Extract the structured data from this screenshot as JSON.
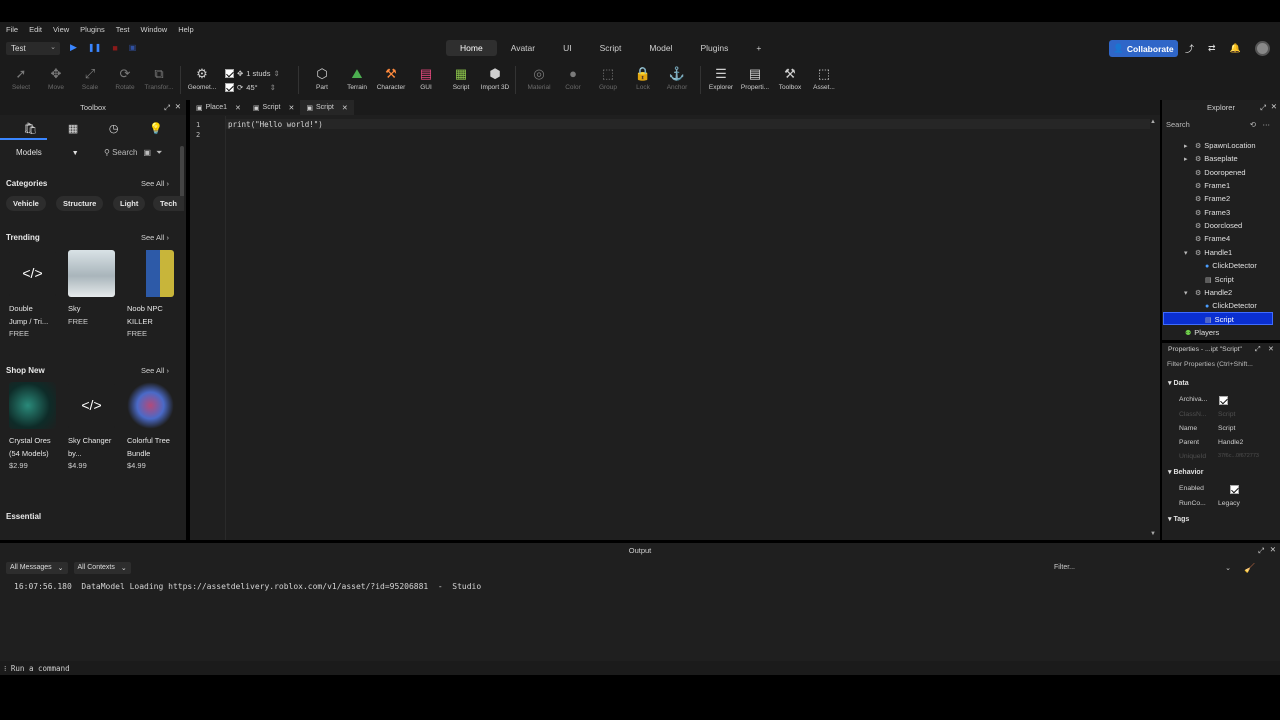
{
  "menu": [
    "File",
    "Edit",
    "View",
    "Plugins",
    "Test",
    "Window",
    "Help"
  ],
  "toolbar": {
    "mode_select": "Test",
    "collaborate_label": "Collaborate"
  },
  "main_tabs": [
    {
      "label": "Home",
      "active": true
    },
    {
      "label": "Avatar"
    },
    {
      "label": "UI"
    },
    {
      "label": "Script"
    },
    {
      "label": "Model"
    },
    {
      "label": "Plugins"
    },
    {
      "label": "+"
    }
  ],
  "ribbon": {
    "tools": [
      {
        "label": "Select",
        "icon": "cursor-icon",
        "dim": true
      },
      {
        "label": "Move",
        "icon": "move-icon",
        "dim": true
      },
      {
        "label": "Scale",
        "icon": "scale-icon",
        "dim": true
      },
      {
        "label": "Rotate",
        "icon": "rotate-icon",
        "dim": true
      },
      {
        "label": "Transfor...",
        "icon": "transform-icon",
        "dim": true
      },
      {
        "label": "Geomet...",
        "icon": "geometry-icon"
      },
      {
        "label": "Part",
        "icon": "part-icon"
      },
      {
        "label": "Terrain",
        "icon": "terrain-icon"
      },
      {
        "label": "Character",
        "icon": "character-icon"
      },
      {
        "label": "GUI",
        "icon": "gui-icon"
      },
      {
        "label": "Script",
        "icon": "script-icon"
      },
      {
        "label": "Import 3D",
        "icon": "import-3d-icon"
      },
      {
        "label": "Material",
        "icon": "material-icon",
        "dim": true
      },
      {
        "label": "Color",
        "icon": "color-icon",
        "dim": true
      },
      {
        "label": "Group",
        "icon": "group-icon",
        "dim": true
      },
      {
        "label": "Lock",
        "icon": "lock-icon",
        "dim": true
      },
      {
        "label": "Anchor",
        "icon": "anchor-icon",
        "dim": true
      },
      {
        "label": "Explorer",
        "icon": "explorer-icon"
      },
      {
        "label": "Properti...",
        "icon": "properties-icon"
      },
      {
        "label": "Toolbox",
        "icon": "toolbox-icon"
      },
      {
        "label": "Asset...",
        "icon": "asset-icon"
      }
    ],
    "snap": {
      "move": "1 studs",
      "rotate": "45°"
    }
  },
  "toolbox": {
    "title": "Toolbox",
    "category_select": "Models",
    "search_placeholder": "Search",
    "sections": {
      "categories": {
        "title": "Categories",
        "see_all": "See All"
      },
      "trending": {
        "title": "Trending",
        "see_all": "See All"
      },
      "shop_new": {
        "title": "Shop New",
        "see_all": "See All"
      },
      "essential": {
        "title": "Essential"
      }
    },
    "chips": [
      "Vehicle",
      "Structure",
      "Light",
      "Tech"
    ],
    "trending_items": [
      {
        "name1": "Double",
        "name2": "Jump / Tri...",
        "price": "FREE"
      },
      {
        "name1": "Sky",
        "name2": "",
        "price": "FREE"
      },
      {
        "name1": "Noob NPC",
        "name2": "KILLER",
        "price": "FREE"
      }
    ],
    "shop_items": [
      {
        "name1": "Crystal Ores",
        "name2": "(54 Models)",
        "price": "$2.99"
      },
      {
        "name1": "Sky Changer",
        "name2": "by...",
        "price": "$4.99"
      },
      {
        "name1": "Colorful Tree",
        "name2": "Bundle",
        "price": "$4.99"
      }
    ]
  },
  "editor": {
    "tabs": [
      {
        "label": "Place1"
      },
      {
        "label": "Script"
      },
      {
        "label": "Script",
        "active": true
      }
    ],
    "lines": [
      "print(\"Hello world!\")",
      ""
    ],
    "line_numbers": [
      "1",
      "2"
    ]
  },
  "explorer": {
    "title": "Explorer",
    "search_placeholder": "Search",
    "tree": [
      {
        "label": "SpawnLocation",
        "indent": 1,
        "arrow": "▸"
      },
      {
        "label": "Baseplate",
        "indent": 1,
        "arrow": "▸"
      },
      {
        "label": "Dooropened",
        "indent": 1,
        "arrow": ""
      },
      {
        "label": "Frame1",
        "indent": 1,
        "arrow": ""
      },
      {
        "label": "Frame2",
        "indent": 1,
        "arrow": ""
      },
      {
        "label": "Frame3",
        "indent": 1,
        "arrow": ""
      },
      {
        "label": "Doorclosed",
        "indent": 1,
        "arrow": ""
      },
      {
        "label": "Frame4",
        "indent": 1,
        "arrow": ""
      },
      {
        "label": "Handle1",
        "indent": 1,
        "arrow": "▾"
      },
      {
        "label": "ClickDetector",
        "indent": 2,
        "arrow": ""
      },
      {
        "label": "Script",
        "indent": 2,
        "arrow": ""
      },
      {
        "label": "Handle2",
        "indent": 1,
        "arrow": "▾"
      },
      {
        "label": "ClickDetector",
        "indent": 2,
        "arrow": ""
      },
      {
        "label": "Script",
        "indent": 2,
        "arrow": "",
        "selected": true
      },
      {
        "label": "Players",
        "indent": 0,
        "arrow": ""
      }
    ]
  },
  "properties": {
    "title": "Properties - ...ipt \"Script\"",
    "filter_placeholder": "Filter Properties (Ctrl+Shift...",
    "categories": {
      "data": "Data",
      "behavior": "Behavior",
      "tags": "Tags"
    },
    "data_rows": [
      {
        "name": "Archiva...",
        "value": "check"
      },
      {
        "name": "ClassN...",
        "value": "Script",
        "dim": true
      },
      {
        "name": "Name",
        "value": "Script"
      },
      {
        "name": "Parent",
        "value": "Handle2"
      },
      {
        "name": "UniqueId",
        "value": "37f6c...0f672773",
        "dim": true
      }
    ],
    "behavior_rows": [
      {
        "name": "Enabled",
        "value": "check"
      },
      {
        "name": "RunCo...",
        "value": "Legacy"
      }
    ]
  },
  "output": {
    "title": "Output",
    "messages_filter": "All Messages",
    "contexts_filter": "All Contexts",
    "filter_placeholder": "Filter...",
    "log": "16:07:56.180  DataModel Loading https://assetdelivery.roblox.com/v1/asset/?id=95206881  -  Studio",
    "command_placeholder": "Run a command"
  }
}
